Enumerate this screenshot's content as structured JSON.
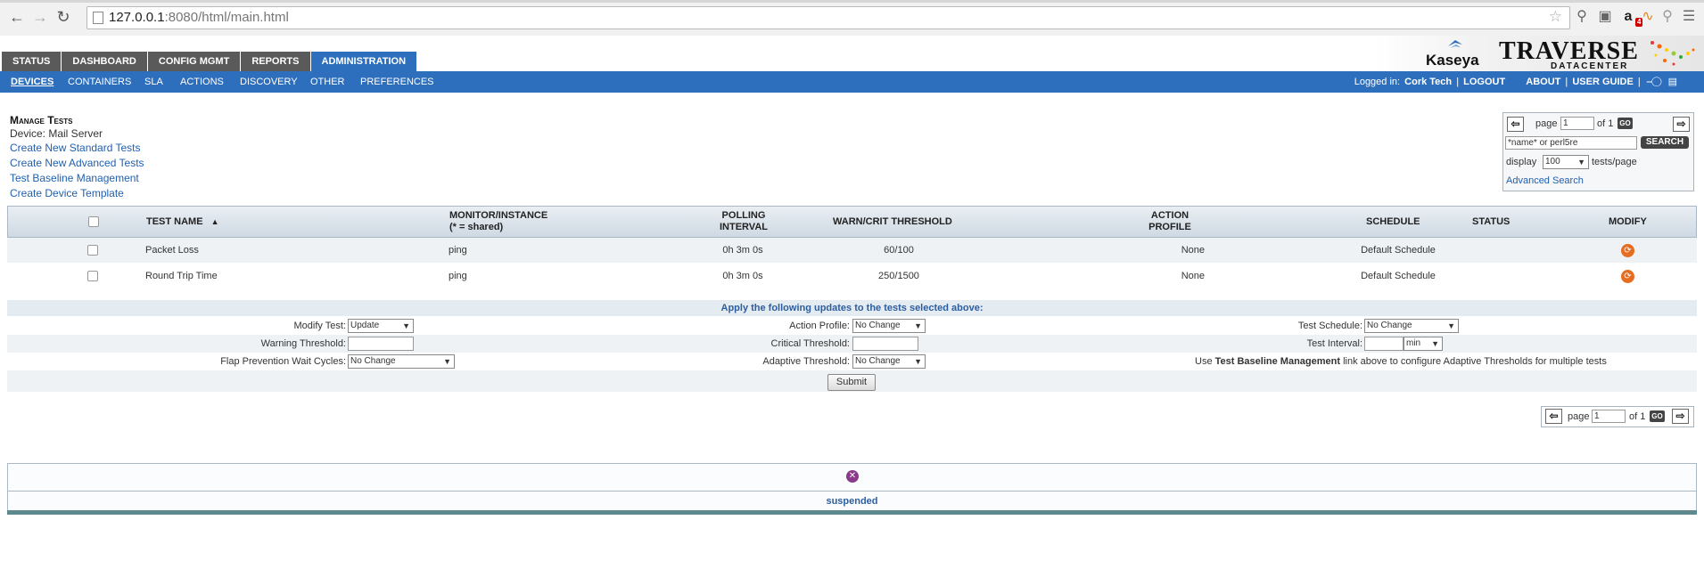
{
  "browser": {
    "url_host": "127.0.0.1",
    "url_rest": ":8080/html/main.html",
    "rss_badge": "4"
  },
  "top_tabs": [
    {
      "label": "STATUS"
    },
    {
      "label": "DASHBOARD"
    },
    {
      "label": "CONFIG MGMT"
    },
    {
      "label": "REPORTS"
    },
    {
      "label": "ADMINISTRATION"
    }
  ],
  "brand": {
    "kaseya": "Kaseya",
    "traverse": "TRAVERSE",
    "datacenter": "DATACENTER"
  },
  "sub_nav": [
    {
      "label": "DEVICES"
    },
    {
      "label": "CONTAINERS"
    },
    {
      "label": "SLA"
    },
    {
      "label": "ACTIONS"
    },
    {
      "label": "DISCOVERY"
    },
    {
      "label": "OTHER"
    },
    {
      "label": "PREFERENCES"
    }
  ],
  "user_bar": {
    "logged_in_label": "Logged in:",
    "user": "Cork Tech",
    "logout": "LOGOUT",
    "about": "ABOUT",
    "user_guide": "USER GUIDE",
    "sep": "|"
  },
  "manage": {
    "title": "Manage Tests",
    "device": "Device: Mail Server",
    "links": [
      "Create New Standard Tests",
      "Create New Advanced Tests",
      "Test Baseline Management",
      "Create Device Template"
    ]
  },
  "pager": {
    "page_label": "page",
    "page_value": "1",
    "of_label": "of 1",
    "go": "GO",
    "search_placeholder": "*name* or perl5re",
    "search_button": "SEARCH",
    "display_label": "display",
    "display_value": "100",
    "per_page_label": "tests/page",
    "advanced_search": "Advanced Search"
  },
  "table": {
    "headers": {
      "test_name": "TEST NAME",
      "sort_arrow": "▲",
      "monitor_1": "MONITOR/INSTANCE",
      "monitor_2": "(* = shared)",
      "polling_1": "POLLING",
      "polling_2": "INTERVAL",
      "threshold": "WARN/CRIT THRESHOLD",
      "action_1": "ACTION",
      "action_2": "PROFILE",
      "schedule": "SCHEDULE",
      "status": "STATUS",
      "modify": "MODIFY"
    },
    "rows": [
      {
        "name": "Packet Loss",
        "monitor": "ping",
        "interval": "0h 3m 0s",
        "threshold": "60/100",
        "action": "None",
        "schedule": "Default Schedule",
        "status": ""
      },
      {
        "name": "Round Trip Time",
        "monitor": "ping",
        "interval": "0h 3m 0s",
        "threshold": "250/1500",
        "action": "None",
        "schedule": "Default Schedule",
        "status": ""
      }
    ]
  },
  "updates": {
    "title": "Apply the following updates to the tests selected above:",
    "modify_test_label": "Modify Test:",
    "modify_test_value": "Update",
    "action_profile_label": "Action Profile:",
    "action_profile_value": "No Change",
    "test_schedule_label": "Test Schedule:",
    "test_schedule_value": "No Change",
    "warning_threshold_label": "Warning Threshold:",
    "critical_threshold_label": "Critical Threshold:",
    "test_interval_label": "Test Interval:",
    "test_interval_unit": "min",
    "flap_label": "Flap Prevention Wait Cycles:",
    "flap_value": "No Change",
    "adaptive_label": "Adaptive Threshold:",
    "adaptive_value": "No Change",
    "note_prefix": "Use",
    "note_link": "Test Baseline Management",
    "note_suffix": "link above to configure Adaptive Thresholds for multiple tests",
    "submit": "Submit"
  },
  "pager_bottom": {
    "page_label": "page",
    "page_value": "1",
    "of_label": "of 1",
    "go": "GO"
  },
  "bottom": {
    "suspended": "suspended"
  }
}
